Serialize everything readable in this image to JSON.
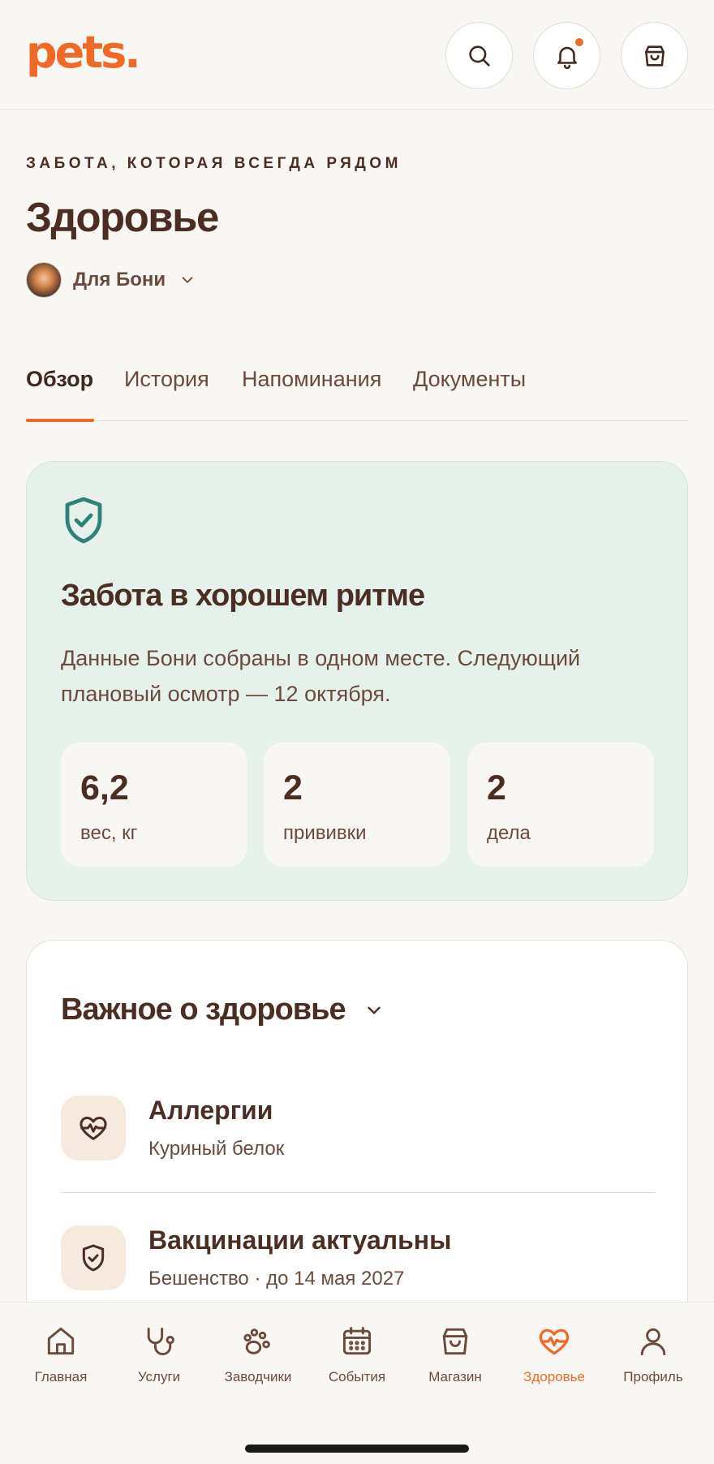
{
  "app": {
    "logo": "pets."
  },
  "header": {
    "icons": [
      "search-icon",
      "bell-icon",
      "bag-icon"
    ],
    "has_notification": true
  },
  "intro": {
    "eyebrow": "ЗАБОТА, КОТОРАЯ ВСЕГДА РЯДОМ",
    "title": "Здоровье",
    "pet_label": "Для Бони"
  },
  "tabs": [
    {
      "label": "Обзор",
      "active": true
    },
    {
      "label": "История",
      "active": false
    },
    {
      "label": "Напоминания",
      "active": false
    },
    {
      "label": "Документы",
      "active": false
    }
  ],
  "status": {
    "icon": "shield-check-icon",
    "title": "Забота в хорошем ритме",
    "text": "Данные Бони собраны в одном месте. Следующий плановый осмотр — 12 октября.",
    "stats": [
      {
        "value": "6,2",
        "label": "вес, кг"
      },
      {
        "value": "2",
        "label": "прививки"
      },
      {
        "value": "2",
        "label": "дела"
      }
    ]
  },
  "important": {
    "title": "Важное о здоровье",
    "items": [
      {
        "icon": "heart-pulse-icon",
        "title": "Аллергии",
        "subtitle": "Куриный белок"
      },
      {
        "icon": "shield-check-icon",
        "title": "Вакцинации актуальны",
        "subtitle": "Бешенство · до 14 мая 2027"
      }
    ]
  },
  "nav": {
    "items": [
      {
        "icon": "home-icon",
        "label": "Главная",
        "active": false
      },
      {
        "icon": "stethoscope-icon",
        "label": "Услуги",
        "active": false
      },
      {
        "icon": "paw-icon",
        "label": "Заводчики",
        "active": false
      },
      {
        "icon": "calendar-icon",
        "label": "События",
        "active": false
      },
      {
        "icon": "bag-icon",
        "label": "Магазин",
        "active": false
      },
      {
        "icon": "heart-pulse-icon",
        "label": "Здоровье",
        "active": true
      },
      {
        "icon": "user-icon",
        "label": "Профиль",
        "active": false
      }
    ]
  },
  "colors": {
    "accent": "#ef6a26",
    "text": "#4a2e24",
    "status_bg": "#e6f1ec",
    "status_icon": "#2f8279",
    "background": "#f9f7f3"
  }
}
